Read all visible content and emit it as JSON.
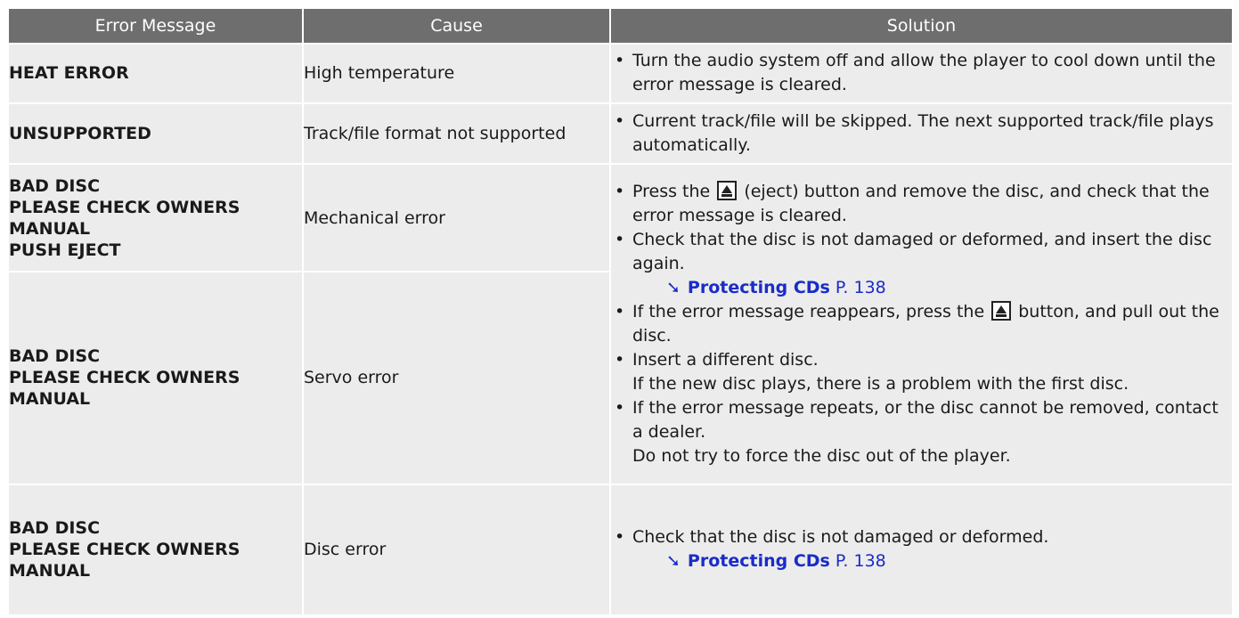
{
  "header": {
    "col_message": "Error Message",
    "col_cause": "Cause",
    "col_solution": "Solution"
  },
  "rows": [
    {
      "message": [
        "HEAT ERROR"
      ],
      "cause": "High temperature",
      "solution": [
        "Turn the audio system off and allow the player to cool down until the error message is cleared."
      ]
    },
    {
      "message": [
        "UNSUPPORTED"
      ],
      "cause": "Track/file format not supported",
      "solution": [
        "Current track/file will be skipped. The next supported track/file plays automatically."
      ]
    },
    {
      "message": [
        "BAD DISC",
        "PLEASE CHECK OWNERS MANUAL",
        "PUSH EJECT"
      ],
      "cause": "Mechanical error"
    },
    {
      "message": [
        "BAD DISC",
        "PLEASE CHECK OWNERS MANUAL"
      ],
      "cause": "Servo error"
    },
    {
      "message": [
        "BAD DISC",
        "PLEASE CHECK OWNERS MANUAL"
      ],
      "cause": "Disc error",
      "solution": [
        "Check that the disc is not damaged or deformed."
      ]
    }
  ],
  "shared_solution": {
    "b1_pre": "Press the",
    "b1_post": "(eject) button and remove the disc, and check that the error message is cleared.",
    "b2": "Check that the disc is not damaged or deformed, and insert the disc again.",
    "b3_pre": "If the error message reappears, press the",
    "b3_post": "button, and pull out the disc.",
    "b4": "Insert a different disc.",
    "b4_sub": "If the new disc plays, there is a problem with the first disc.",
    "b5": "If the error message repeats, or the disc cannot be removed, contact a dealer.",
    "b5_sub": "Do not try to force the disc out of the player."
  },
  "xref": {
    "icon": "➘",
    "title": "Protecting CDs",
    "page": "P. 138",
    "icon_name": "cross-reference-arrow-icon",
    "color": "#1a2cc8"
  },
  "eject_icon": "eject-icon",
  "colors": {
    "header_bg": "#6e6e6e",
    "row_bg": "#ececec",
    "link": "#1a2cc8"
  }
}
